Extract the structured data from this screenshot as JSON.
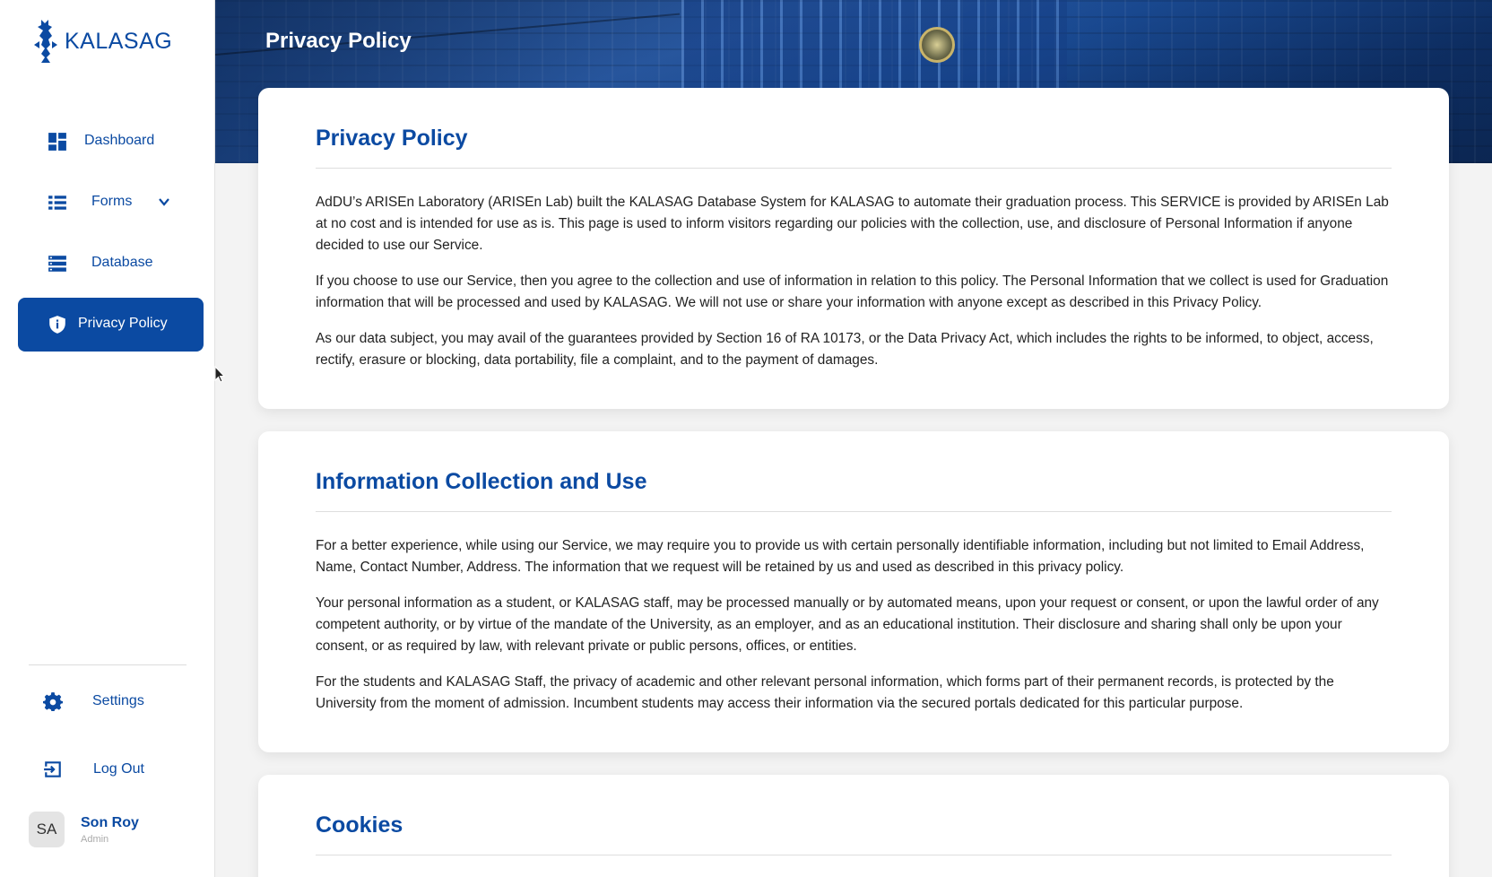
{
  "app": {
    "name": "KALASAG"
  },
  "sidebar": {
    "items": [
      {
        "label": "Dashboard",
        "icon": "dashboard-icon"
      },
      {
        "label": "Forms",
        "icon": "list-icon",
        "has_dropdown": true
      },
      {
        "label": "Database",
        "icon": "database-icon"
      },
      {
        "label": "Privacy Policy",
        "icon": "shield-icon",
        "active": true
      }
    ],
    "settings_label": "Settings",
    "logout_label": "Log Out",
    "user": {
      "initials": "SA",
      "name": "Son Roy",
      "role": "Admin"
    }
  },
  "header": {
    "title": "Privacy Policy"
  },
  "sections": [
    {
      "title": "Privacy Policy",
      "paragraphs": [
        "AdDU’s ARISEn Laboratory (ARISEn Lab) built the KALASAG Database System for KALASAG to automate their graduation process. This SERVICE is provided by ARISEn Lab at no cost and is intended for use as is. This page is used to inform visitors regarding our policies with the collection, use, and disclosure of Personal Information if anyone decided to use our Service.",
        "If you choose to use our Service, then you agree to the collection and use of information in relation to this policy. The Personal Information that we collect is used for Graduation information that will be processed and used by KALASAG. We will not use or share your information with anyone except as described in this Privacy Policy.",
        "As our data subject, you may avail of the guarantees provided by Section 16 of RA 10173, or the Data Privacy Act, which includes the rights to be informed, to object, access, rectify, erasure or blocking, data portability, file a complaint, and to the payment of damages."
      ]
    },
    {
      "title": "Information Collection and Use",
      "paragraphs": [
        "For a better experience, while using our Service, we may require you to provide us with certain personally identifiable information, including but not limited to Email Address, Name, Contact Number, Address. The information that we request will be retained by us and used as described in this privacy policy.",
        "Your personal information as a student, or KALASAG staff, may be processed manually or by automated means, upon your request or consent, or upon the lawful order of any competent authority, or by virtue of the mandate of the University, as an employer, and as an educational institution. Their disclosure and sharing shall only be upon your consent, or as required by law, with relevant private or public persons, offices, or entities.",
        "For the students and KALASAG Staff, the privacy of academic and other relevant personal information, which forms part of their permanent records, is protected by the University from the moment of admission. Incumbent students may access their information via the secured portals dedicated for this particular purpose."
      ]
    },
    {
      "title": "Cookies",
      "paragraphs": []
    }
  ],
  "colors": {
    "accent": "#0b4aa2",
    "background": "#f3f3f3"
  }
}
